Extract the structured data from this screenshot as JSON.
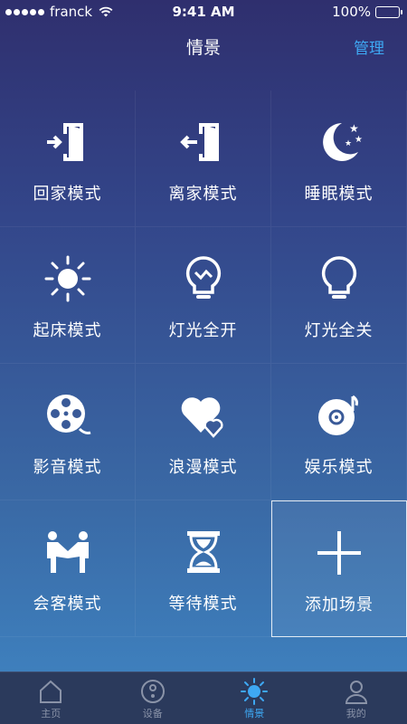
{
  "status_bar": {
    "carrier": "franck",
    "time": "9:41 AM",
    "battery": "100%"
  },
  "nav": {
    "title": "情景",
    "action": "管理"
  },
  "scenes": [
    {
      "label": "回家模式",
      "icon": "enter-door-icon"
    },
    {
      "label": "离家模式",
      "icon": "exit-door-icon"
    },
    {
      "label": "睡眠模式",
      "icon": "moon-stars-icon"
    },
    {
      "label": "起床模式",
      "icon": "sun-icon"
    },
    {
      "label": "灯光全开",
      "icon": "lightbulb-on-icon"
    },
    {
      "label": "灯光全关",
      "icon": "lightbulb-off-icon"
    },
    {
      "label": "影音模式",
      "icon": "film-reel-icon"
    },
    {
      "label": "浪漫模式",
      "icon": "hearts-icon"
    },
    {
      "label": "娱乐模式",
      "icon": "music-disc-icon"
    },
    {
      "label": "会客模式",
      "icon": "handshake-icon"
    },
    {
      "label": "等待模式",
      "icon": "hourglass-icon"
    },
    {
      "label": "添加场景",
      "icon": "plus-icon"
    }
  ],
  "tabs": [
    {
      "label": "主页",
      "icon": "home-icon"
    },
    {
      "label": "设备",
      "icon": "device-icon"
    },
    {
      "label": "情景",
      "icon": "scene-sun-icon",
      "active": true
    },
    {
      "label": "我的",
      "icon": "user-icon"
    }
  ],
  "colors": {
    "accent": "#3ea8f3",
    "tab_bar": "#2b3a5c",
    "tab_inactive": "#8a93a8"
  }
}
